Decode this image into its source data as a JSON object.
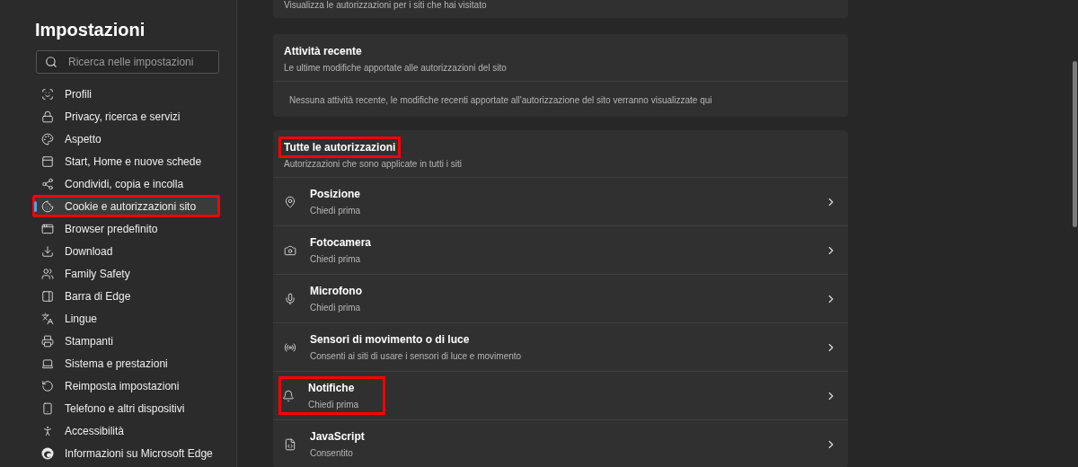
{
  "sidebar": {
    "title": "Impostazioni",
    "search": {
      "placeholder": "Ricerca nelle impostazioni"
    },
    "items": [
      {
        "label": "Profili",
        "selected": false,
        "highlighted": false
      },
      {
        "label": "Privacy, ricerca e servizi",
        "selected": false,
        "highlighted": false
      },
      {
        "label": "Aspetto",
        "selected": false,
        "highlighted": false
      },
      {
        "label": "Start, Home e nuove schede",
        "selected": false,
        "highlighted": false
      },
      {
        "label": "Condividi, copia e incolla",
        "selected": false,
        "highlighted": false
      },
      {
        "label": "Cookie e autorizzazioni sito",
        "selected": true,
        "highlighted": true
      },
      {
        "label": "Browser predefinito",
        "selected": false,
        "highlighted": false
      },
      {
        "label": "Download",
        "selected": false,
        "highlighted": false
      },
      {
        "label": "Family Safety",
        "selected": false,
        "highlighted": false
      },
      {
        "label": "Barra di Edge",
        "selected": false,
        "highlighted": false
      },
      {
        "label": "Lingue",
        "selected": false,
        "highlighted": false
      },
      {
        "label": "Stampanti",
        "selected": false,
        "highlighted": false
      },
      {
        "label": "Sistema e prestazioni",
        "selected": false,
        "highlighted": false
      },
      {
        "label": "Reimposta impostazioni",
        "selected": false,
        "highlighted": false
      },
      {
        "label": "Telefono e altri dispositivi",
        "selected": false,
        "highlighted": false
      },
      {
        "label": "Accessibilità",
        "selected": false,
        "highlighted": false
      },
      {
        "label": "Informazioni su Microsoft Edge",
        "selected": false,
        "highlighted": false
      }
    ]
  },
  "top_card": {
    "subtitle": "Visualizza le autorizzazioni per i siti che hai visitato"
  },
  "recent_activity": {
    "title": "Attività recente",
    "subtitle": "Le ultime modifiche apportate alle autorizzazioni del sito",
    "message": "Nessuna attività recente, le modifiche recenti apportate all'autorizzazione del sito verranno visualizzate qui"
  },
  "all_permissions": {
    "title": "Tutte le autorizzazioni",
    "title_highlighted": true,
    "subtitle": "Autorizzazioni che sono applicate in tutti i siti",
    "items": [
      {
        "title": "Posizione",
        "status": "Chiedi prima",
        "highlighted": false
      },
      {
        "title": "Fotocamera",
        "status": "Chiedi prima",
        "highlighted": false
      },
      {
        "title": "Microfono",
        "status": "Chiedi prima",
        "highlighted": false
      },
      {
        "title": "Sensori di movimento o di luce",
        "status": "Consenti ai siti di usare i sensori di luce e movimento",
        "highlighted": false
      },
      {
        "title": "Notifiche",
        "status": "Chiedi prima",
        "highlighted": true
      },
      {
        "title": "JavaScript",
        "status": "Consentito",
        "highlighted": false
      }
    ]
  }
}
